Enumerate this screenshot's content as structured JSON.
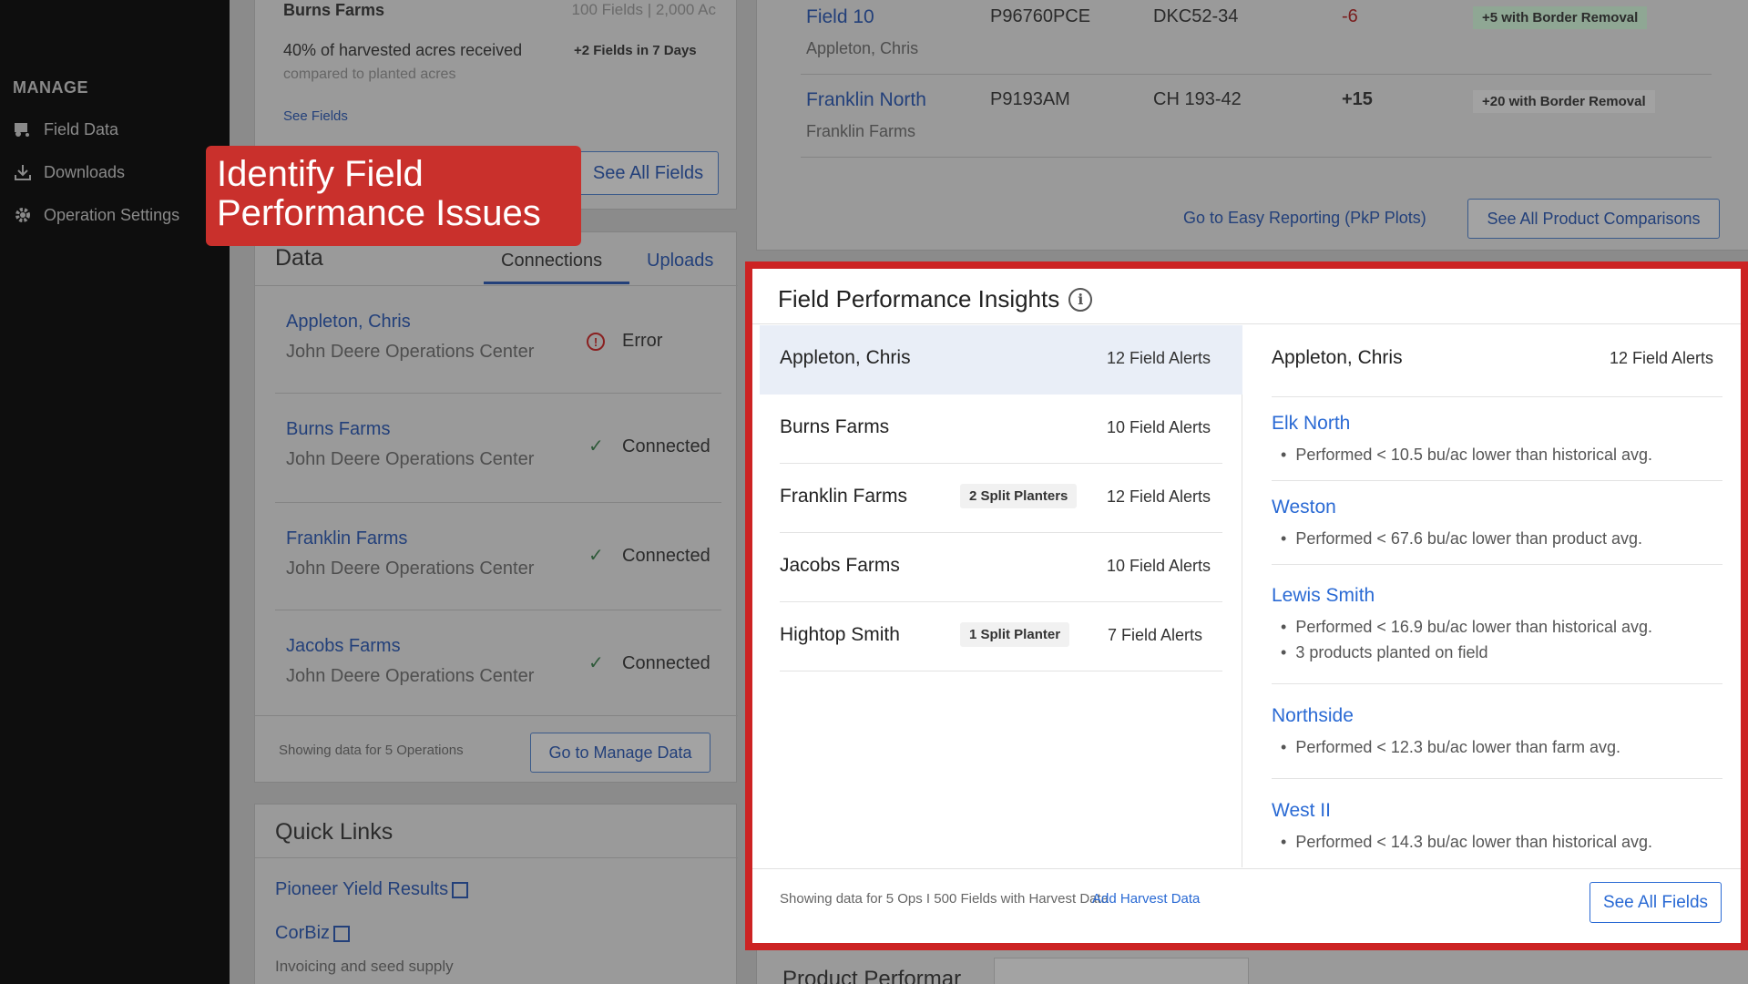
{
  "sidebar": {
    "section_label": "MANAGE",
    "items": [
      {
        "label": "Field Data",
        "icon": "tractor-icon"
      },
      {
        "label": "Downloads",
        "icon": "download-icon"
      },
      {
        "label": "Operation Settings",
        "icon": "gear-icon"
      }
    ]
  },
  "top_left": {
    "farm": "Burns Farms",
    "meta": "100 Fields | 2,000 Ac",
    "harvest_line": "40% of harvested acres received",
    "harvest_sub": "compared to planted acres",
    "new_fields": "+2 Fields in 7 Days",
    "see_fields": "See Fields",
    "see_all_fields": "See All Fields"
  },
  "callout": {
    "line1": "Identify Field",
    "line2": "Performance Issues"
  },
  "data_card": {
    "title": "Data",
    "tabs": [
      "Connections",
      "Uploads"
    ],
    "rows": [
      {
        "name": "Appleton, Chris",
        "source": "John Deere Operations Center",
        "status": "Error"
      },
      {
        "name": "Burns Farms",
        "source": "John Deere Operations Center",
        "status": "Connected"
      },
      {
        "name": "Franklin Farms",
        "source": "John Deere Operations Center",
        "status": "Connected"
      },
      {
        "name": "Jacobs Farms",
        "source": "John Deere Operations Center",
        "status": "Connected"
      }
    ],
    "footer_text": "Showing data for 5 Operations",
    "manage_button": "Go to Manage Data"
  },
  "quick_links": {
    "title": "Quick Links",
    "links": [
      "Pioneer Yield Results",
      "CorBiz"
    ],
    "corbiz_desc": "Invoicing and seed supply"
  },
  "product_table": {
    "rows": [
      {
        "field": "Field 10",
        "owner": "Appleton, Chris",
        "product": "P96760PCE",
        "hybrid": "DKC52-34",
        "diff": "-6",
        "note": "+5 with Border Removal"
      },
      {
        "field": "Franklin North",
        "owner": "Franklin Farms",
        "product": "P9193AM",
        "hybrid": "CH 193-42",
        "diff": "+15",
        "note": "+20 with Border Removal"
      }
    ],
    "easy_reporting": "Go to Easy Reporting (PkP Plots)",
    "see_all_comparisons": "See All Product Comparisons"
  },
  "insights": {
    "title": "Field Performance Insights",
    "operations": [
      {
        "name": "Appleton, Chris",
        "alerts": "12 Field Alerts",
        "badge": ""
      },
      {
        "name": "Burns Farms",
        "alerts": "10 Field Alerts",
        "badge": ""
      },
      {
        "name": "Franklin Farms",
        "alerts": "12 Field Alerts",
        "badge": "2 Split Planters"
      },
      {
        "name": "Jacobs Farms",
        "alerts": "10 Field Alerts",
        "badge": ""
      },
      {
        "name": "Hightop Smith",
        "alerts": "7 Field Alerts",
        "badge": "1 Split Planter"
      }
    ],
    "detail": {
      "name": "Appleton, Chris",
      "alerts": "12 Field Alerts",
      "fields": [
        {
          "name": "Elk North",
          "notes": [
            "Performed < 10.5 bu/ac lower than historical avg."
          ]
        },
        {
          "name": "Weston",
          "notes": [
            "Performed < 67.6 bu/ac lower than product avg."
          ]
        },
        {
          "name": "Lewis Smith",
          "notes": [
            "Performed < 16.9 bu/ac lower than historical avg.",
            "3 products planted on field"
          ]
        },
        {
          "name": "Northside",
          "notes": [
            "Performed < 12.3 bu/ac lower than farm avg."
          ]
        },
        {
          "name": "West II",
          "notes": [
            "Performed < 14.3 bu/ac lower than historical avg."
          ]
        }
      ]
    },
    "footer_text": "Showing data for 5 Ops I 500 Fields with Harvest Data",
    "add_harvest": "Add Harvest Data",
    "see_all_fields": "See All Fields"
  },
  "bottom": {
    "product_title": "Product Performar"
  },
  "colors": {
    "highlight": "#cc2323",
    "link": "#2a6ad4",
    "sidebar_bg": "#0e0e0e"
  }
}
